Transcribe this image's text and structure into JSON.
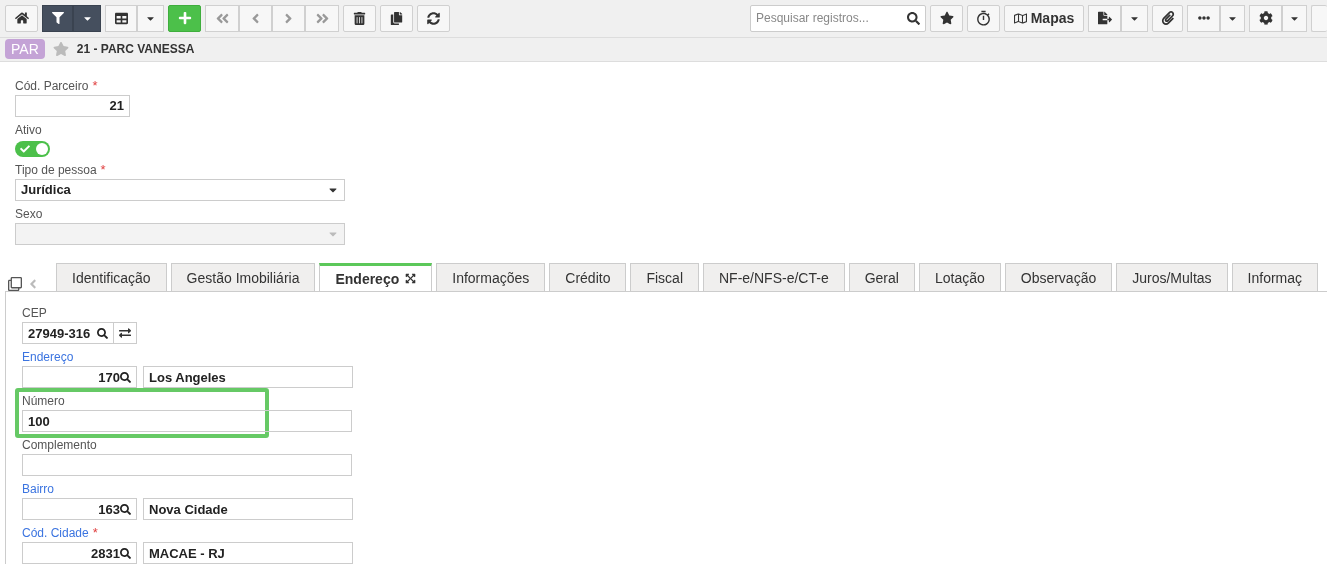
{
  "toolbar": {
    "filter_active": true,
    "search": {
      "placeholder": "Pesquisar registros..."
    },
    "maps_label": "Mapas"
  },
  "header": {
    "badge": "PAR",
    "favorite": false,
    "title": "21 - PARC VANESSA"
  },
  "form": {
    "fields": [
      {
        "kind": "number",
        "label": "Cód. Parceiro",
        "required_mark": "*",
        "value": "21"
      },
      {
        "kind": "switch",
        "label": "Ativo",
        "on": true
      },
      {
        "kind": "select",
        "label": "Tipo de pessoa",
        "required_mark": "*",
        "value": "Jurídica",
        "disabled": false
      },
      {
        "kind": "select",
        "label": "Sexo",
        "disabled": true
      }
    ]
  },
  "tabs": [
    {
      "label": "Identificação",
      "selected": false
    },
    {
      "label": "Gestão Imobiliária",
      "selected": false
    },
    {
      "label": "Endereço",
      "selected": true
    },
    {
      "label": "Informações",
      "selected": false
    },
    {
      "label": "Crédito",
      "selected": false
    },
    {
      "label": "Fiscal",
      "selected": false
    },
    {
      "label": "NF-e/NFS-e/CT-e",
      "selected": false
    },
    {
      "label": "Geral",
      "selected": false
    },
    {
      "label": "Lotação",
      "selected": false
    },
    {
      "label": "Observação",
      "selected": false
    },
    {
      "label": "Juros/Multas",
      "selected": false
    },
    {
      "label": "Informaç",
      "selected": false
    }
  ],
  "address": {
    "fields": [
      {
        "kind": "cep",
        "label": "CEP",
        "linked": false,
        "highlighted": false,
        "code": "27949-316"
      },
      {
        "kind": "lookup",
        "label": "Endereço",
        "linked": true,
        "highlighted": false,
        "code": "170",
        "description": "Los Angeles"
      },
      {
        "kind": "text",
        "label": "Número",
        "linked": false,
        "highlighted": true,
        "value": "100"
      },
      {
        "kind": "text",
        "label": "Complemento",
        "linked": false,
        "highlighted": false
      },
      {
        "kind": "lookup",
        "label": "Bairro",
        "linked": true,
        "highlighted": false,
        "code": "163",
        "description": "Nova Cidade"
      },
      {
        "kind": "lookup",
        "label": "Cód. Cidade",
        "linked": true,
        "required_mark": "*",
        "highlighted": false,
        "code": "2831",
        "description": "MACAE - RJ"
      }
    ]
  }
}
